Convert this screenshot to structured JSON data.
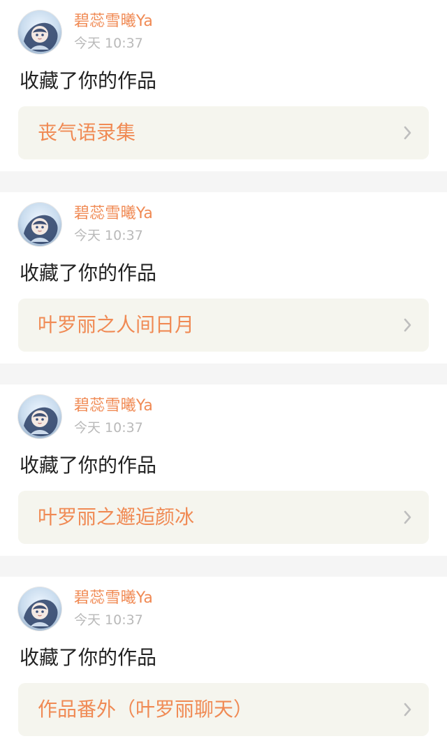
{
  "notifications": [
    {
      "username": "碧蕊雪曦Ya",
      "time": "今天 10:37",
      "action": "收藏了你的作品",
      "work_title": "丧气语录集",
      "chevron_icon": "chevron-right-icon"
    },
    {
      "username": "碧蕊雪曦Ya",
      "time": "今天 10:37",
      "action": "收藏了你的作品",
      "work_title": "叶罗丽之人间日月",
      "chevron_icon": "chevron-right-icon"
    },
    {
      "username": "碧蕊雪曦Ya",
      "time": "今天 10:37",
      "action": "收藏了你的作品",
      "work_title": "叶罗丽之邂逅颜冰",
      "chevron_icon": "chevron-right-icon"
    },
    {
      "username": "碧蕊雪曦Ya",
      "time": "今天 10:37",
      "action": "收藏了你的作品",
      "work_title": "作品番外（叶罗丽聊天）",
      "chevron_icon": "chevron-right-icon"
    }
  ],
  "colors": {
    "accent": "#f08a54",
    "time": "#b9b9b9",
    "text": "#222222",
    "work_bg": "#f5f5ee",
    "page_bg": "#f5f5f5"
  }
}
